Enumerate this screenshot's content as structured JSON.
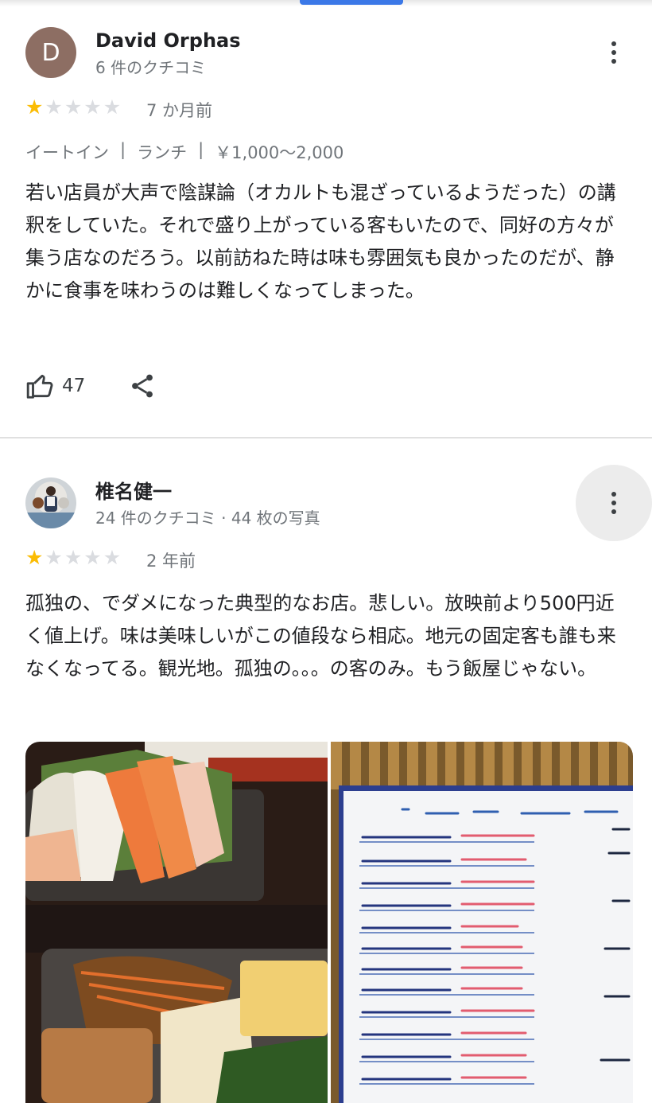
{
  "reviews": [
    {
      "avatar_letter": "D",
      "name": "David Orphas",
      "meta": "6 件のクチコミ",
      "rating": 1,
      "age": "7 か月前",
      "tags": [
        "イートイン",
        "|",
        "ランチ",
        "|",
        "￥1,000～2,000"
      ],
      "text": "若い店員が大声で陰謀論（オカルトも混ざっているようだった）の講釈をしていた。それで盛り上がっている客もいたので、同好の方々が集う店なのだろう。以前訪ねた時は味も雰囲気も良かったのだが、静かに食事を味わうのは難しくなってしまった。",
      "likes": "47",
      "like_icon": "thumb-up-icon",
      "share_icon": "share-icon"
    },
    {
      "name": "椎名健一",
      "meta": "24 件のクチコミ · 44 枚の写真",
      "rating": 1,
      "age": "2 年前",
      "text": "孤独の、でダメになった典型的なお店。悲しい。放映前より500円近く値上げ。味は美味しいがこの値段なら相応。地元の固定客も誰も来なくなってる。観光地。孤独の。。。の客のみ。もう飯屋じゃない。",
      "photos": [
        "sashimi-teishoku-photo",
        "dinner-menu-board-photo"
      ]
    }
  ],
  "colors": {
    "star_on": "#fbbc04",
    "star_off": "#dadce0",
    "accent": "#3b78e7",
    "avatar_bg": "#8d6e63"
  }
}
